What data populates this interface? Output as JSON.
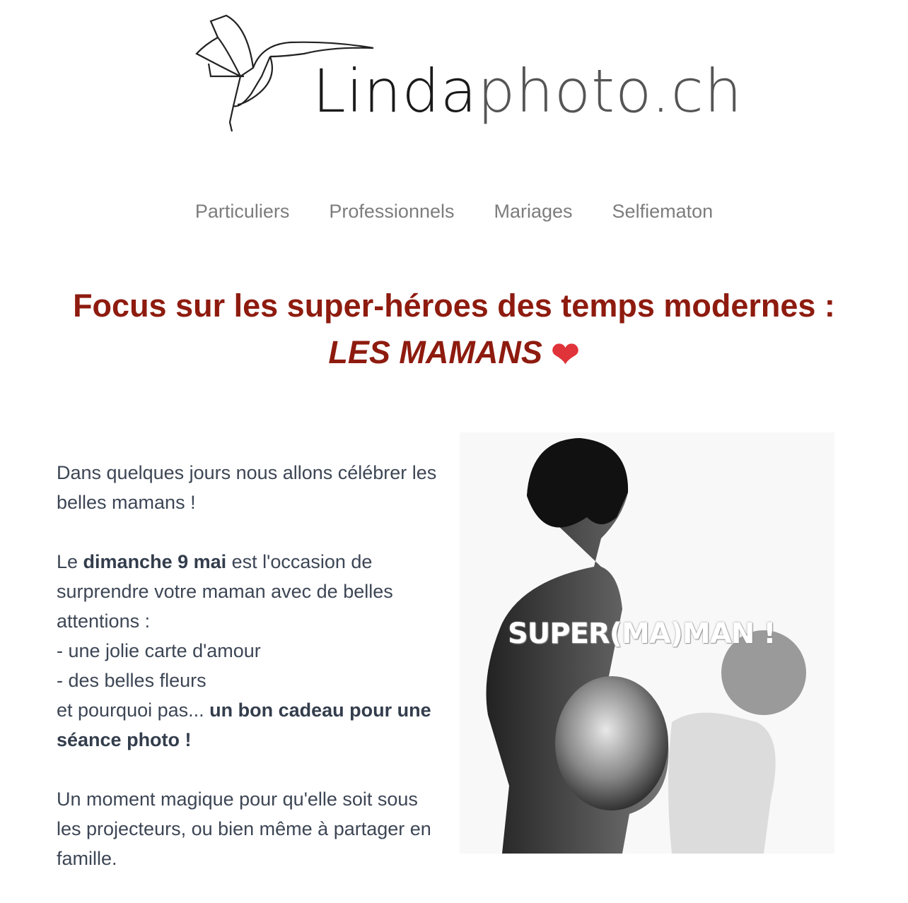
{
  "logo": {
    "text_bold": "Linda",
    "text_light": "photo.ch",
    "icon": "hummingbird-icon"
  },
  "nav": {
    "items": [
      {
        "label": "Particuliers"
      },
      {
        "label": "Professionnels"
      },
      {
        "label": "Mariages"
      },
      {
        "label": "Selfiematon"
      }
    ]
  },
  "headline": {
    "line1": "Focus sur les super-héroes des temps modernes :",
    "line2": "LES MAMANS",
    "emoji": "❤"
  },
  "body": {
    "p1": "Dans quelques jours nous allons célébrer les belles mamans !",
    "p2_a": "Le ",
    "p2_b": "dimanche 9 mai",
    "p2_c": " est l'occasion de surprendre votre maman avec de belles attentions :",
    "li1": "-  une jolie carte d'amour",
    "li2": "- des belles fleurs",
    "p3_a": "et pourquoi pas... ",
    "p3_b": "un bon cadeau pour une séance photo !",
    "p4": "Un moment magique pour qu'elle soit sous les projecteurs, ou bien même à partager en famille."
  },
  "photo": {
    "caption": "SUPER(MA)MAN !"
  },
  "colors": {
    "headline": "#8e1b0f",
    "nav": "#7d7d7d",
    "body": "#3d4655",
    "heart": "#e0333a"
  }
}
